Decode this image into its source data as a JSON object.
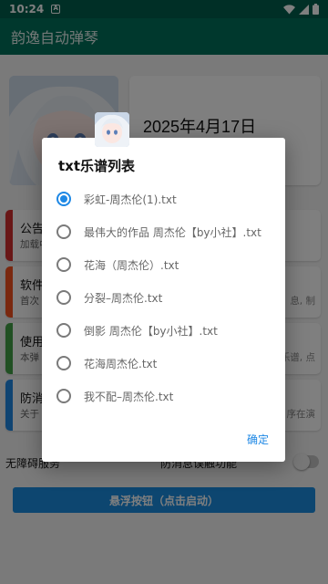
{
  "status_bar": {
    "time": "10:24",
    "noti_glyph": "A"
  },
  "app_bar": {
    "title": "韵逸自动弹琴"
  },
  "date_card": {
    "date": "2025年4月17日"
  },
  "cards": [
    {
      "title": "公告",
      "sub": "加载中",
      "accent": "#d32f2f"
    },
    {
      "title": "软件",
      "sub": "首次",
      "right": "息, 制",
      "accent": "#f4511e"
    },
    {
      "title": "使用",
      "sub": "本弹",
      "right": "乐谱, 点",
      "accent": "#43a047"
    },
    {
      "title": "防消",
      "sub": "关于",
      "right": "序在演",
      "accent": "#1e88e5"
    }
  ],
  "switches": {
    "accessibility": "无障碍服务",
    "anti_kill": "防消息误触功能"
  },
  "float_button": "悬浮按钮（点击启动）",
  "dialog": {
    "title": "txt乐谱列表",
    "options": [
      {
        "label": "彩虹-周杰伦(1).txt",
        "checked": true
      },
      {
        "label": "最伟大的作品 周杰伦【by小社】.txt",
        "checked": false
      },
      {
        "label": "花海（周杰伦）.txt",
        "checked": false
      },
      {
        "label": "分裂–周杰伦.txt",
        "checked": false
      },
      {
        "label": "倒影 周杰伦【by小社】.txt",
        "checked": false
      },
      {
        "label": "花海周杰伦.txt",
        "checked": false
      },
      {
        "label": "我不配–周杰伦.txt",
        "checked": false
      }
    ],
    "ok_label": "确定"
  },
  "colors": {
    "status_bar": "#005f4c",
    "app_bar": "#00705a",
    "accent": "#1e88e5"
  },
  "icons": [
    "notification-icon",
    "wifi-icon",
    "signal-icon",
    "battery-icon",
    "avatar-image"
  ]
}
